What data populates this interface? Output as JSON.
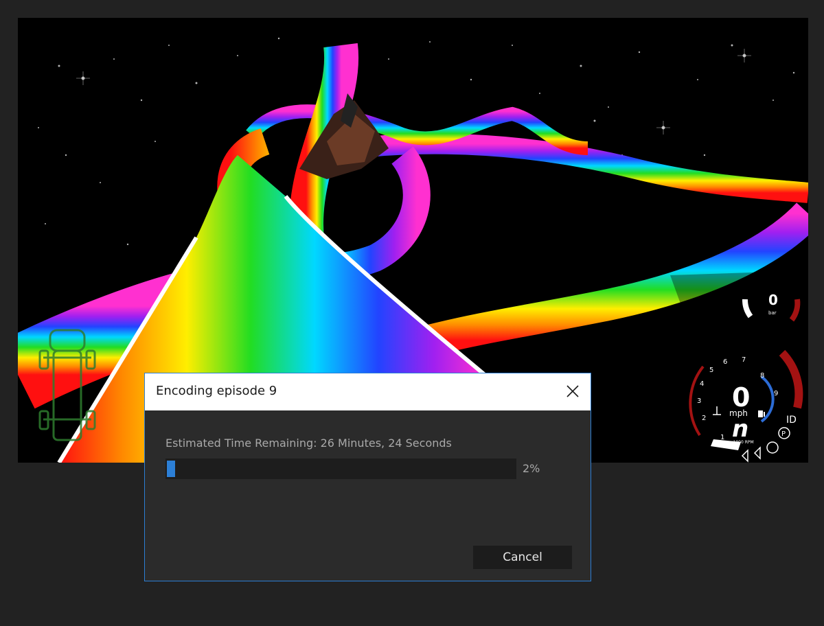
{
  "dialog": {
    "title": "Encoding episode 9",
    "status_text": "Estimated Time Remaining: 26 Minutes, 24 Seconds",
    "progress_percent": 2,
    "progress_label": "2%",
    "cancel_label": "Cancel",
    "accent_color": "#2c7fd6"
  },
  "hud": {
    "tach_numbers": [
      "1",
      "2",
      "3",
      "4",
      "5",
      "6",
      "7",
      "8",
      "9"
    ],
    "speed_value": "0",
    "speed_unit": "mph",
    "gear_label": "n",
    "rpm_unit": "x1000 RPM",
    "id_label": "ID",
    "park_label": "P",
    "small_gauge_value": "0",
    "small_gauge_unit": "bar"
  },
  "icons": {
    "close": "close-icon",
    "fuel": "fuel-icon",
    "temp": "temperature-icon",
    "turn_signals": "turn-signal-icon",
    "car_diagram": "car-damage-icon"
  }
}
